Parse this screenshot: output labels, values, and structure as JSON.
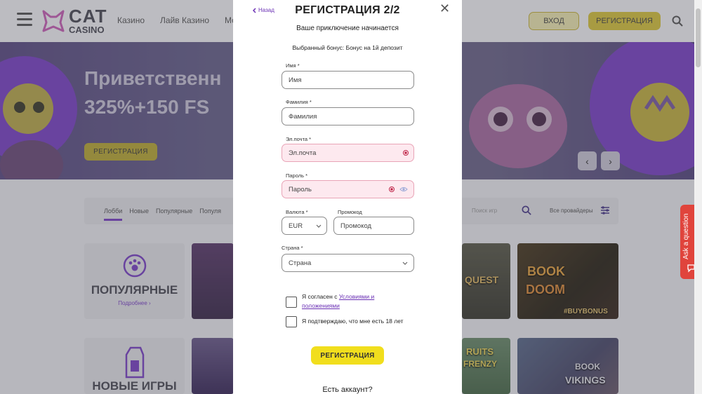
{
  "header": {
    "logo_big": "CAT",
    "logo_small": "CASINO",
    "nav": [
      "Казино",
      "Лайв Казино",
      "Мо"
    ],
    "login": "ВХОД",
    "register": "РЕГИСТРАЦИЯ"
  },
  "banner": {
    "title_line1": "Приветственн",
    "title_line2": "325%+150 FS",
    "button": "РЕГИСТРАЦИЯ",
    "prev": "‹",
    "next": "›"
  },
  "filters": {
    "tabs": [
      "Лобби",
      "Новые",
      "Популярные",
      "Популя"
    ],
    "search_placeholder": "Поиск игр",
    "providers": "Все провайдеры"
  },
  "categories": {
    "popular": {
      "title": "ПОПУЛЯРНЫЕ",
      "more": "Подробнее"
    },
    "new": {
      "title": "НОВЫЕ ИГРЫ"
    }
  },
  "games": {
    "book_of_doom": {
      "line1": "BOOK",
      "line2": "DOOM",
      "badge": "#BUYBONUS"
    },
    "book_of_vikings": {
      "line1": "BOOK",
      "line2": "VIKINGS"
    },
    "quest": "QUEST",
    "fruits": "RUITS",
    "frenzy": "FRENZY"
  },
  "ask": {
    "label": "Ask a question"
  },
  "modal": {
    "back": "Назад",
    "title": "РЕГИСТРАЦИЯ 2/2",
    "close": "✕",
    "subtitle": "Ваше приключение начинается",
    "bonus": "Выбранный бонус: Бонус на 1й депозит",
    "first_name": {
      "label": "Имя *",
      "placeholder": "Имя"
    },
    "last_name": {
      "label": "Фамилия *",
      "placeholder": "Фамилия"
    },
    "email": {
      "label": "Эл.почта *",
      "placeholder": "Эл.почта"
    },
    "password": {
      "label": "Пароль *",
      "placeholder": "Пароль"
    },
    "currency": {
      "label": "Валюта *",
      "value": "EUR"
    },
    "promo": {
      "label": "Промокод",
      "placeholder": "Промокод"
    },
    "country": {
      "label": "Страна *",
      "value": "Страна"
    },
    "terms_prefix": "Я согласен с ",
    "terms_link_1": "Условиями и",
    "terms_link_2": "положениями",
    "age": "Я подтверждаю, что мне есть 18 лет",
    "submit": "РЕГИСТРАЦИЯ",
    "have_account": "Есть аккаунт?"
  },
  "colors": {
    "accent_purple": "#6a2fb4",
    "brand_yellow": "#f1de1d",
    "error_pink": "#fde9ef",
    "ask_red": "#e0443c"
  }
}
